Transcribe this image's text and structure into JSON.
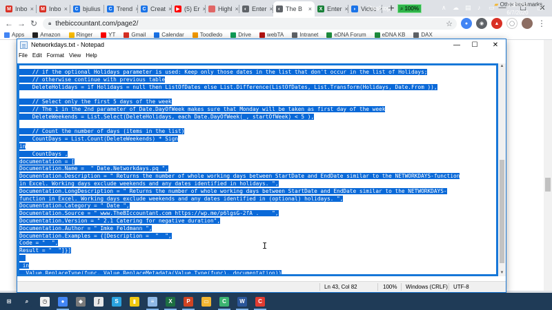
{
  "browser": {
    "tabs": [
      {
        "label": "Inbo",
        "favicon": "gmail-icon",
        "color": "#d93025",
        "glyph": "M"
      },
      {
        "label": "Inbo",
        "favicon": "gmail-icon",
        "color": "#d93025",
        "glyph": "M"
      },
      {
        "label": "bjulius",
        "favicon": "chrome-site-icon",
        "color": "#1a73e8",
        "glyph": "C"
      },
      {
        "label": "Trend",
        "favicon": "chrome-site-icon",
        "color": "#1a73e8",
        "glyph": "C"
      },
      {
        "label": "Creat",
        "favicon": "chrome-site-icon",
        "color": "#1a73e8",
        "glyph": "C"
      },
      {
        "label": "(5) Er",
        "favicon": "youtube-icon",
        "color": "#ff0000",
        "glyph": "▶"
      },
      {
        "label": "Highl",
        "favicon": "generic-site-icon",
        "color": "#e06666",
        "glyph": ""
      },
      {
        "label": "Enter",
        "favicon": "globe-icon",
        "color": "#5f6368",
        "glyph": "◐"
      },
      {
        "label": "The B",
        "favicon": "globe-icon",
        "color": "#5f6368",
        "glyph": "◐",
        "active": true
      },
      {
        "label": "Enter",
        "favicon": "sheets-icon",
        "color": "#188038",
        "glyph": "X"
      },
      {
        "label": "Videc",
        "favicon": "video-icon",
        "color": "#1a73e8",
        "glyph": "◗"
      }
    ],
    "url": "thebiccountant.com/page2/",
    "window_controls": [
      "—",
      "☐",
      "✕"
    ],
    "bookmarks": [
      {
        "label": "Apps",
        "color": "#4285f4"
      },
      {
        "label": "Amazon",
        "color": "#222222"
      },
      {
        "label": "Ringer",
        "color": "#fbbc04"
      },
      {
        "label": "YT",
        "color": "#ff0000"
      },
      {
        "label": "Gmail",
        "color": "#d93025"
      },
      {
        "label": "Calendar",
        "color": "#1a73e8"
      },
      {
        "label": "Toodledo",
        "color": "#f29900"
      },
      {
        "label": "Drive",
        "color": "#0f9d58"
      },
      {
        "label": "webTA",
        "color": "#b31412"
      },
      {
        "label": "Intranet",
        "color": "#5f6368"
      },
      {
        "label": "eDNA Forum",
        "color": "#1e8e3e"
      },
      {
        "label": "eDNA KB",
        "color": "#1e8e3e"
      },
      {
        "label": "DAX",
        "color": "#5f6368"
      }
    ],
    "other_bookmarks": "Other bookmarks"
  },
  "notepad": {
    "title": "Networkdays.txt - Notepad",
    "menu": [
      "File",
      "Edit",
      "Format",
      "View",
      "Help"
    ],
    "lines": [
      "    // if the optional Holidays parameter is used: Keep only those dates in the list that don't occur in the list of Holidays;",
      "    // otherwise continue with previous table",
      "    DeleteHolidays = if Holidays = null then ListOfDates else List.Difference(ListOfDates, List.Transform(Holidays, Date.From )),",
      "",
      "    // Select only the first 5 days of the week",
      "    // The 1 in the 2nd parameter of Date.DayOfWeek makes sure that Monday will be taken as first day of the week",
      "    DeleteWeekends = List.Select(DeleteHolidays, each Date.DayOfWeek(_, startOfWeek) < 5 ),",
      "",
      "    // Count the number of days (items in the list)",
      "    CountDays = List.Count(DeleteWeekends) * Sign",
      "in",
      "    CountDays ,",
      "documentation = [",
      "Documentation.Name =  \" Date.Networkdays.pq \",",
      "Documentation.Description = \" Returns the number of whole working days between StartDate and EndDate similar to the NETWORKDAYS-function",
      "in Excel. Working days exclude weekends and any dates identified in holidays. \",",
      "Documentation.LongDescription = \" Returns the number of whole working days between StartDate and EndDate similar to the NETWORKDAYS-",
      "function in Excel. Working days exclude weekends and any dates identified in (optional) holidays. \",",
      "Documentation.Category = \" Date \",",
      "Documentation.Source = \" www.TheBIccountant.com https://wp.me/p6lgsG-2fA .    \",",
      "Documentation.Version = \" 2.1 Catering for negative duration\",",
      "Documentation.Author = \" Imke Feldmann \",",
      "Documentation.Examples = {[Description =  \"  \",",
      "Code = \"  \",",
      "Result = \"  \"]}]",
      "  ",
      " in",
      "  Value.ReplaceType(func, Value.ReplaceMetadata(Value.Type(func), documentation))"
    ],
    "status": {
      "position": "Ln 43, Col 82",
      "zoom": "100%",
      "line_ending": "Windows (CRLF)",
      "encoding": "UTF-8"
    },
    "selection_color": "#0a69d8"
  },
  "taskbar": {
    "desktop_label": "Desktop",
    "zoom_badge": "100%",
    "clock_time": "9:30 PM",
    "clock_date": "6/7/2020",
    "apps": [
      {
        "name": "start-icon",
        "color": "#1f3b57",
        "glyph": "⊞",
        "open": false
      },
      {
        "name": "search-icon",
        "color": "#1f3b57",
        "glyph": "⌕",
        "open": false
      },
      {
        "name": "clock-app-icon",
        "color": "#f1f1f1",
        "glyph": "◷",
        "open": false
      },
      {
        "name": "chrome-icon",
        "color": "#4285f4",
        "glyph": "●",
        "open": true
      },
      {
        "name": "davinci-icon",
        "color": "#7a7a7a",
        "glyph": "◆",
        "open": false
      },
      {
        "name": "feather-icon",
        "color": "#e8e8e8",
        "glyph": "ʃ",
        "open": false
      },
      {
        "name": "snagit-icon",
        "color": "#2aa3e0",
        "glyph": "S",
        "open": false
      },
      {
        "name": "powerbi-icon",
        "color": "#f2c811",
        "glyph": "▮",
        "open": false
      },
      {
        "name": "notepad-app-icon",
        "color": "#8fb9e6",
        "glyph": "≡",
        "open": true
      },
      {
        "name": "excel-icon",
        "color": "#1d6f42",
        "glyph": "X",
        "open": true
      },
      {
        "name": "powerpoint-icon",
        "color": "#d04423",
        "glyph": "P",
        "open": true
      },
      {
        "name": "file-explorer-icon",
        "color": "#f2b632",
        "glyph": "▭",
        "open": false
      },
      {
        "name": "camtasia-icon",
        "color": "#3cb371",
        "glyph": "C",
        "open": true
      },
      {
        "name": "word-icon",
        "color": "#2b579a",
        "glyph": "W",
        "open": true
      },
      {
        "name": "camtasia-recorder-icon",
        "color": "#e03c31",
        "glyph": "C",
        "open": true
      }
    ]
  }
}
